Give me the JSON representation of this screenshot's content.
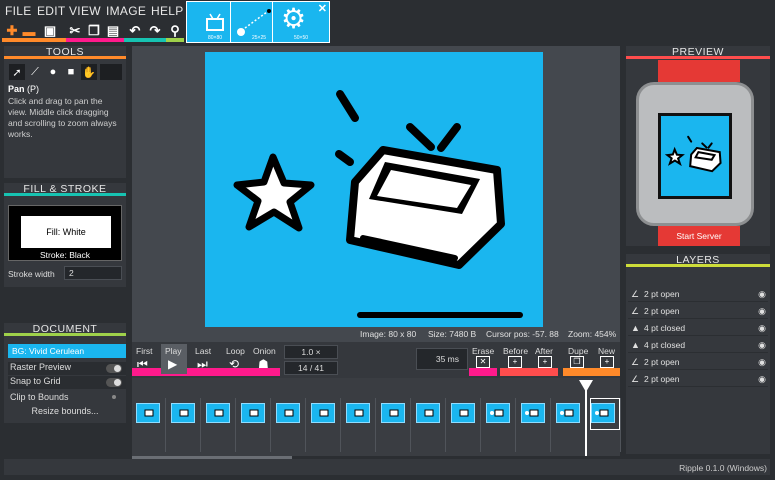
{
  "menu": {
    "file": "FILE",
    "edit": "EDIT",
    "view": "VIEW",
    "image": "IMAGE",
    "help": "HELP"
  },
  "tabs": [
    {
      "caption": "80×80"
    },
    {
      "caption": "25×25"
    },
    {
      "caption": "50×50"
    }
  ],
  "tools": {
    "title": "TOOLS",
    "tool_name": "Pan",
    "shortcut": "(P)",
    "help": "Click and drag to pan the view. Middle click dragging and scrolling to zoom always works."
  },
  "fill_stroke": {
    "title": "FILL & STROKE",
    "fill": "Fill: White",
    "stroke": "Stroke: Black",
    "stroke_width_label": "Stroke width",
    "stroke_width": "2"
  },
  "document": {
    "title": "DOCUMENT",
    "bg": "BG: Vivid Cerulean",
    "raster_preview": "Raster Preview",
    "snap_to_grid": "Snap to Grid",
    "clip_to_bounds": "Clip to Bounds",
    "resize_bounds": "Resize bounds..."
  },
  "status": {
    "image": "Image: 80 x 80",
    "size": "Size: 7480 B",
    "cursor": "Cursor pos: -57. 88",
    "zoom": "Zoom: 454%"
  },
  "timeline": {
    "first": "First",
    "play": "Play",
    "last": "Last",
    "loop": "Loop",
    "onion": "Onion",
    "speed": "1.0 ×",
    "frame_pos": "14 / 41",
    "ms": "35 ms",
    "erase": "Erase",
    "before": "Before",
    "after": "After",
    "dupe": "Dupe",
    "new": "New"
  },
  "preview": {
    "title": "PREVIEW",
    "start_server": "Start Server"
  },
  "layers": {
    "title": "LAYERS",
    "items": [
      {
        "name": "2 pt open",
        "icon": "open-path"
      },
      {
        "name": "2 pt open",
        "icon": "open-path"
      },
      {
        "name": "4 pt closed",
        "icon": "closed-path"
      },
      {
        "name": "4 pt closed",
        "icon": "closed-path"
      },
      {
        "name": "2 pt open",
        "icon": "open-path"
      },
      {
        "name": "2 pt open",
        "icon": "open-path"
      }
    ]
  },
  "footer": {
    "version": "Ripple 0.1.0 (Windows)"
  },
  "colors": {
    "canvas": "#1ab6ef",
    "accent_orange": "#ff8a2a",
    "accent_teal": "#17c3b2",
    "accent_green": "#9fd14a",
    "accent_magenta": "#ff1a8c",
    "accent_red": "#ff4d4d",
    "watch_red": "#e53935"
  }
}
